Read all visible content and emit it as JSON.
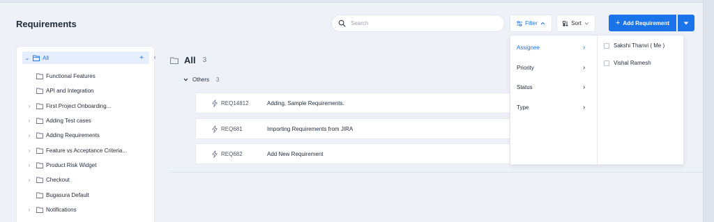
{
  "page": {
    "title": "Requirements"
  },
  "search": {
    "placeholder": "Search"
  },
  "toolbar": {
    "filter_label": "Filter",
    "sort_label": "Sort",
    "add_label": "Add Requirement"
  },
  "sidebar": {
    "items": [
      {
        "label": "All",
        "expandable": true,
        "selected": true
      },
      {
        "label": "Functional Features",
        "expandable": false
      },
      {
        "label": "API and Integration",
        "expandable": false
      },
      {
        "label": "First Project Onboarding...",
        "expandable": true
      },
      {
        "label": "Adding Test cases",
        "expandable": true
      },
      {
        "label": "Adding Requirements",
        "expandable": true
      },
      {
        "label": "Feature vs Acceptance Criteria...",
        "expandable": true
      },
      {
        "label": "Product Risk Widget",
        "expandable": true
      },
      {
        "label": "Checkout",
        "expandable": true
      },
      {
        "label": "Bugasura Default",
        "expandable": false
      },
      {
        "label": "Notifications",
        "expandable": true
      }
    ]
  },
  "main": {
    "title": "All",
    "count": "3",
    "group": {
      "label": "Others",
      "count": "3"
    },
    "requirements": [
      {
        "id": "REQ14812",
        "title": "Adding, Sample Requirements."
      },
      {
        "id": "REQ681",
        "title": "Importing Requirements from JIRA"
      },
      {
        "id": "REQ682",
        "title": "Add New Requirement"
      }
    ]
  },
  "filter_menu": {
    "categories": [
      {
        "label": "Assignee",
        "active": true
      },
      {
        "label": "Priority",
        "active": false
      },
      {
        "label": "Status",
        "active": false
      },
      {
        "label": "Type",
        "active": false
      }
    ],
    "options": [
      {
        "label": "Sakshi Thanvi ( Me )",
        "checked": false
      },
      {
        "label": "Vishal Ramesh",
        "checked": false
      }
    ]
  },
  "colors": {
    "accent": "#1a73e8",
    "background": "#eef2f8",
    "selected_bg": "#e4eefc"
  }
}
